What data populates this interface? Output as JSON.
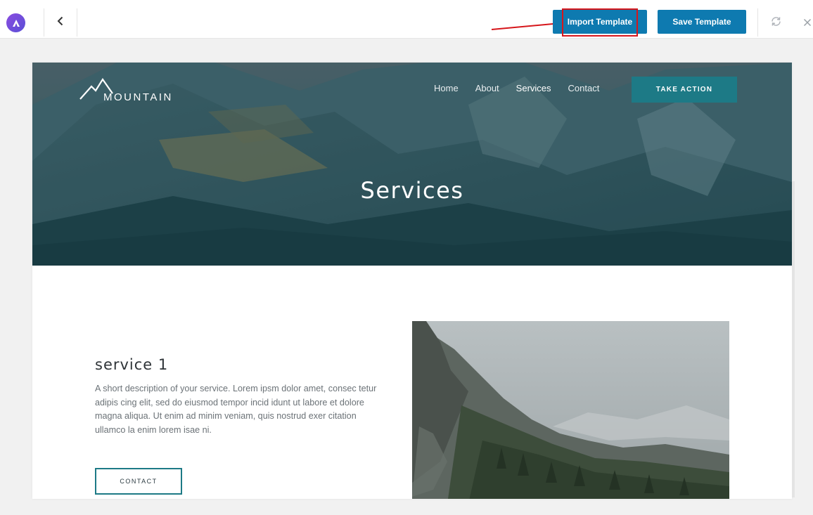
{
  "toolbar": {
    "import_label": "Import Template",
    "save_label": "Save Template"
  },
  "header": {
    "brand": "MOUNTAIN",
    "nav": [
      "Home",
      "About",
      "Services",
      "Contact"
    ],
    "active_nav": "Services",
    "cta_label": "TAKE ACTION"
  },
  "hero": {
    "title": "Services"
  },
  "service": {
    "heading": "service 1",
    "description": "A short description of your service. Lorem ipsm dolor amet, consec tetur adipis cing elit, sed do eiusmod tempor incid idunt ut labore et dolore magna aliqua. Ut enim ad minim veniam, quis nostrud exer citation ullamco la enim lorem isae ni.",
    "button_label": "CONTACT"
  },
  "icons": {
    "app_logo": "app-logo-icon",
    "back": "chevron-left-icon",
    "refresh": "refresh-icon",
    "close": "close-icon"
  },
  "colors": {
    "primary_button": "#0e7ab0",
    "highlight": "#d6161b",
    "teal_accent": "#1d7a86",
    "logo_purple": "#7b4fe0"
  }
}
